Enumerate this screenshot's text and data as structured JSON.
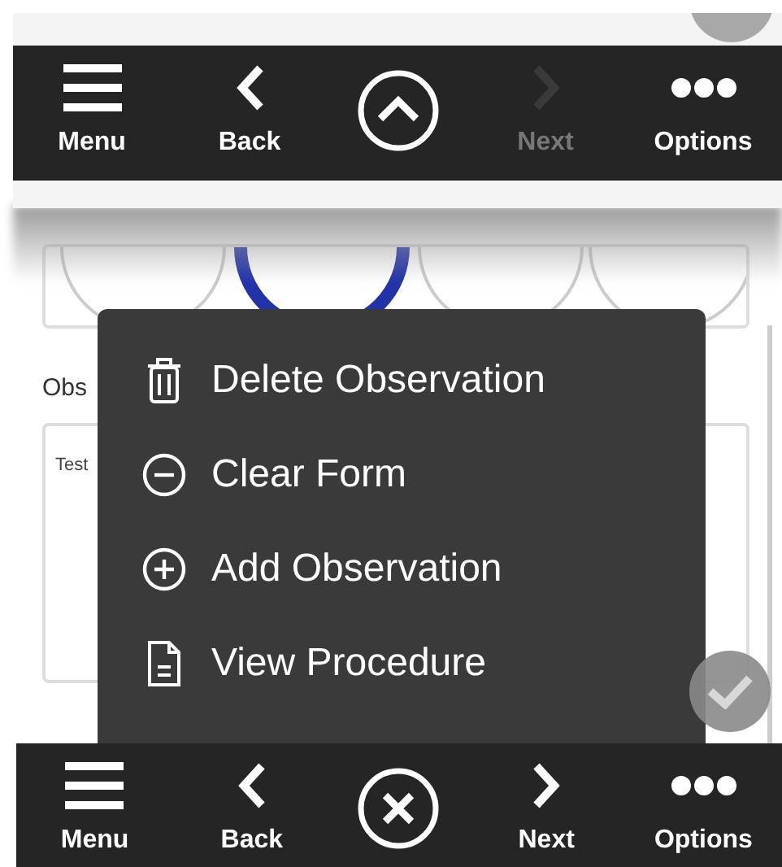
{
  "form": {
    "label": "Obs",
    "notes_value": "Test"
  },
  "menu": {
    "items": [
      {
        "kind": "trash",
        "label": "Delete Observation"
      },
      {
        "kind": "minus",
        "label": "Clear Form"
      },
      {
        "kind": "plus",
        "label": "Add Observation"
      },
      {
        "kind": "document",
        "label": "View Procedure"
      }
    ]
  },
  "zoomed_toolbar": {
    "center": {
      "kind": "up"
    },
    "items": [
      {
        "kind": "menu",
        "label": "Menu",
        "disabled": false
      },
      {
        "kind": "back",
        "label": "Back",
        "disabled": false
      },
      {
        "kind": "next",
        "label": "Next",
        "disabled": true
      },
      {
        "kind": "options",
        "label": "Options",
        "disabled": false
      }
    ]
  },
  "toolbar": {
    "center": {
      "kind": "close"
    },
    "items": [
      {
        "kind": "menu",
        "label": "Menu",
        "disabled": false
      },
      {
        "kind": "back",
        "label": "Back",
        "disabled": false
      },
      {
        "kind": "next",
        "label": "Next",
        "disabled": false
      },
      {
        "kind": "options",
        "label": "Options",
        "disabled": false
      }
    ]
  }
}
